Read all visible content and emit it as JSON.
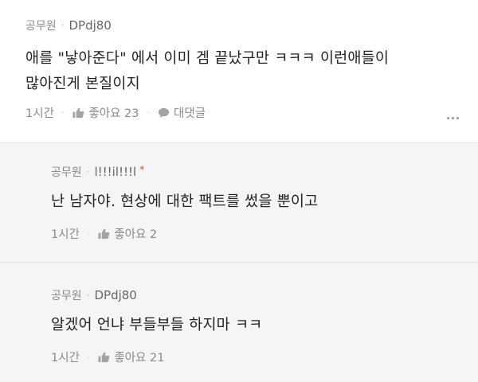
{
  "comments": {
    "main": {
      "author": "공무원",
      "nickname": "DPdj80",
      "line1": "애를 \"낳아준다\" 에서 이미 겜 끝났구만 ㅋㅋㅋ 이런애들이",
      "line2": "많아진게 본질이지",
      "time": "1시간",
      "like_label": "좋아요 23",
      "reply_label": "대댓글"
    },
    "reply1": {
      "author": "공무원",
      "nickname": "l!!!il!!!l",
      "badge": "*",
      "text": "난 남자야. 현상에 대한 팩트를 썼을 뿐이고",
      "time": "1시간",
      "like_label": "좋아요 2"
    },
    "reply2": {
      "author": "공무원",
      "nickname": "DPdj80",
      "text": "알겠어 언냐 부들부들 하지마 ㅋㅋ",
      "time": "1시간",
      "like_label": "좋아요 21"
    }
  },
  "icons": {
    "like": "thumbs-up-icon",
    "reply": "speech-bubble-icon",
    "more": "more-dots-icon"
  },
  "colors": {
    "badge": "#e8453c",
    "text": "#222222",
    "muted": "#8a8a8a"
  }
}
